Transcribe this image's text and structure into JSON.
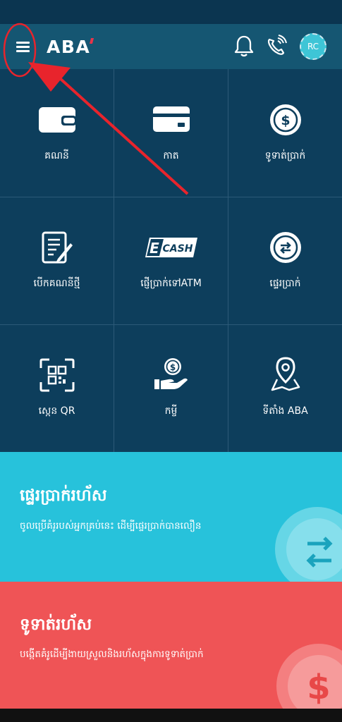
{
  "header": {
    "logo_text": "ABA",
    "avatar_initials": "RC"
  },
  "grid": {
    "items": [
      {
        "label": "គណនី",
        "icon": "wallet-icon"
      },
      {
        "label": "កាត",
        "icon": "card-icon"
      },
      {
        "label": "ទូទាត់ប្រាក់",
        "icon": "dollar-coin-icon"
      },
      {
        "label": "បើកគណនីថ្មី",
        "icon": "document-edit-icon"
      },
      {
        "label": "ផ្ញើប្រាក់ទៅATM",
        "icon": "ecash-icon",
        "badge": "CASH"
      },
      {
        "label": "ផ្ទេរប្រាក់",
        "icon": "transfer-arrows-icon"
      },
      {
        "label": "ស្កេន QR",
        "icon": "qr-scan-icon"
      },
      {
        "label": "កម្ចី",
        "icon": "hand-coin-icon"
      },
      {
        "label": "ទីតាំង ABA",
        "icon": "location-pin-icon"
      }
    ]
  },
  "banners": {
    "transfer": {
      "title": "ផ្ទេរប្រាក់រហ័ស",
      "desc": "ចូលប្រើគំរូរបស់អ្នកគ្រប់នេះ ដើម្បីផ្ទេរប្រាក់បានលឿន"
    },
    "payment": {
      "title": "ទូទាត់រហ័ស",
      "desc": "បង្កើតគំរូដើម្បីងាយស្រួលនិងរហ័សក្នុងការទូទាត់ប្រាក់"
    }
  },
  "colors": {
    "header": "#155672",
    "grid_bg": "#0d3e5c",
    "banner_blue": "#27c2db",
    "banner_red": "#ef5456",
    "annotation": "#e8242c"
  }
}
